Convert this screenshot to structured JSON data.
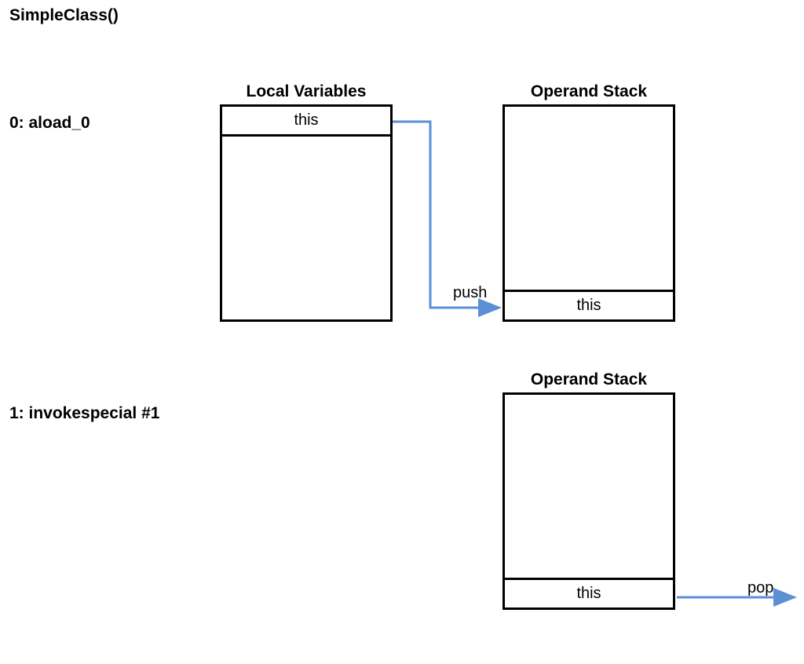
{
  "title": "SimpleClass()",
  "step1": {
    "instruction": "0: aload_0",
    "local_vars_title": "Local Variables",
    "local_vars_value": "this",
    "operand_stack_title": "Operand Stack",
    "operand_stack_value": "this",
    "arrow_label": "push"
  },
  "step2": {
    "instruction": "1: invokespecial #1",
    "operand_stack_title": "Operand Stack",
    "operand_stack_value": "this",
    "arrow_label": "pop"
  }
}
